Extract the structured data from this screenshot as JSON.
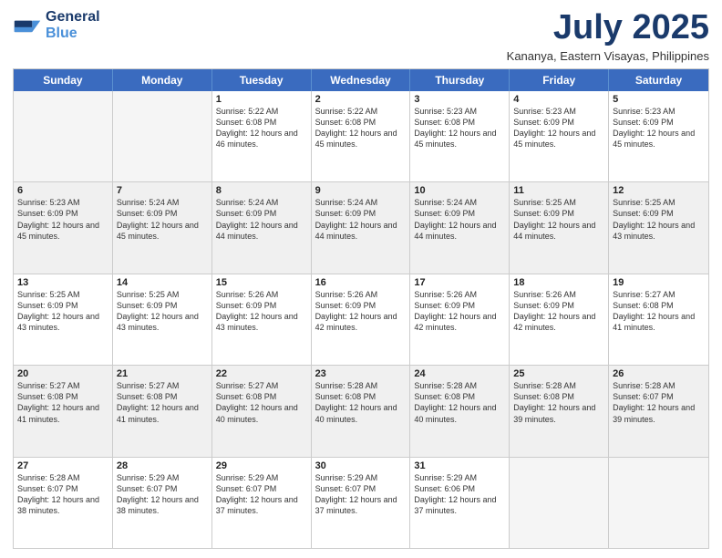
{
  "logo": {
    "line1": "General",
    "line2": "Blue"
  },
  "title": "July 2025",
  "subtitle": "Kananya, Eastern Visayas, Philippines",
  "days": [
    "Sunday",
    "Monday",
    "Tuesday",
    "Wednesday",
    "Thursday",
    "Friday",
    "Saturday"
  ],
  "rows": [
    [
      {
        "day": "",
        "info": "",
        "empty": true
      },
      {
        "day": "",
        "info": "",
        "empty": true
      },
      {
        "day": "1",
        "info": "Sunrise: 5:22 AM\nSunset: 6:08 PM\nDaylight: 12 hours and 46 minutes."
      },
      {
        "day": "2",
        "info": "Sunrise: 5:22 AM\nSunset: 6:08 PM\nDaylight: 12 hours and 45 minutes."
      },
      {
        "day": "3",
        "info": "Sunrise: 5:23 AM\nSunset: 6:08 PM\nDaylight: 12 hours and 45 minutes."
      },
      {
        "day": "4",
        "info": "Sunrise: 5:23 AM\nSunset: 6:09 PM\nDaylight: 12 hours and 45 minutes."
      },
      {
        "day": "5",
        "info": "Sunrise: 5:23 AM\nSunset: 6:09 PM\nDaylight: 12 hours and 45 minutes."
      }
    ],
    [
      {
        "day": "6",
        "info": "Sunrise: 5:23 AM\nSunset: 6:09 PM\nDaylight: 12 hours and 45 minutes.",
        "shaded": true
      },
      {
        "day": "7",
        "info": "Sunrise: 5:24 AM\nSunset: 6:09 PM\nDaylight: 12 hours and 45 minutes.",
        "shaded": true
      },
      {
        "day": "8",
        "info": "Sunrise: 5:24 AM\nSunset: 6:09 PM\nDaylight: 12 hours and 44 minutes.",
        "shaded": true
      },
      {
        "day": "9",
        "info": "Sunrise: 5:24 AM\nSunset: 6:09 PM\nDaylight: 12 hours and 44 minutes.",
        "shaded": true
      },
      {
        "day": "10",
        "info": "Sunrise: 5:24 AM\nSunset: 6:09 PM\nDaylight: 12 hours and 44 minutes.",
        "shaded": true
      },
      {
        "day": "11",
        "info": "Sunrise: 5:25 AM\nSunset: 6:09 PM\nDaylight: 12 hours and 44 minutes.",
        "shaded": true
      },
      {
        "day": "12",
        "info": "Sunrise: 5:25 AM\nSunset: 6:09 PM\nDaylight: 12 hours and 43 minutes.",
        "shaded": true
      }
    ],
    [
      {
        "day": "13",
        "info": "Sunrise: 5:25 AM\nSunset: 6:09 PM\nDaylight: 12 hours and 43 minutes."
      },
      {
        "day": "14",
        "info": "Sunrise: 5:25 AM\nSunset: 6:09 PM\nDaylight: 12 hours and 43 minutes."
      },
      {
        "day": "15",
        "info": "Sunrise: 5:26 AM\nSunset: 6:09 PM\nDaylight: 12 hours and 43 minutes."
      },
      {
        "day": "16",
        "info": "Sunrise: 5:26 AM\nSunset: 6:09 PM\nDaylight: 12 hours and 42 minutes."
      },
      {
        "day": "17",
        "info": "Sunrise: 5:26 AM\nSunset: 6:09 PM\nDaylight: 12 hours and 42 minutes."
      },
      {
        "day": "18",
        "info": "Sunrise: 5:26 AM\nSunset: 6:09 PM\nDaylight: 12 hours and 42 minutes."
      },
      {
        "day": "19",
        "info": "Sunrise: 5:27 AM\nSunset: 6:08 PM\nDaylight: 12 hours and 41 minutes."
      }
    ],
    [
      {
        "day": "20",
        "info": "Sunrise: 5:27 AM\nSunset: 6:08 PM\nDaylight: 12 hours and 41 minutes.",
        "shaded": true
      },
      {
        "day": "21",
        "info": "Sunrise: 5:27 AM\nSunset: 6:08 PM\nDaylight: 12 hours and 41 minutes.",
        "shaded": true
      },
      {
        "day": "22",
        "info": "Sunrise: 5:27 AM\nSunset: 6:08 PM\nDaylight: 12 hours and 40 minutes.",
        "shaded": true
      },
      {
        "day": "23",
        "info": "Sunrise: 5:28 AM\nSunset: 6:08 PM\nDaylight: 12 hours and 40 minutes.",
        "shaded": true
      },
      {
        "day": "24",
        "info": "Sunrise: 5:28 AM\nSunset: 6:08 PM\nDaylight: 12 hours and 40 minutes.",
        "shaded": true
      },
      {
        "day": "25",
        "info": "Sunrise: 5:28 AM\nSunset: 6:08 PM\nDaylight: 12 hours and 39 minutes.",
        "shaded": true
      },
      {
        "day": "26",
        "info": "Sunrise: 5:28 AM\nSunset: 6:07 PM\nDaylight: 12 hours and 39 minutes.",
        "shaded": true
      }
    ],
    [
      {
        "day": "27",
        "info": "Sunrise: 5:28 AM\nSunset: 6:07 PM\nDaylight: 12 hours and 38 minutes."
      },
      {
        "day": "28",
        "info": "Sunrise: 5:29 AM\nSunset: 6:07 PM\nDaylight: 12 hours and 38 minutes."
      },
      {
        "day": "29",
        "info": "Sunrise: 5:29 AM\nSunset: 6:07 PM\nDaylight: 12 hours and 37 minutes."
      },
      {
        "day": "30",
        "info": "Sunrise: 5:29 AM\nSunset: 6:07 PM\nDaylight: 12 hours and 37 minutes."
      },
      {
        "day": "31",
        "info": "Sunrise: 5:29 AM\nSunset: 6:06 PM\nDaylight: 12 hours and 37 minutes."
      },
      {
        "day": "",
        "info": "",
        "empty": true
      },
      {
        "day": "",
        "info": "",
        "empty": true
      }
    ]
  ]
}
